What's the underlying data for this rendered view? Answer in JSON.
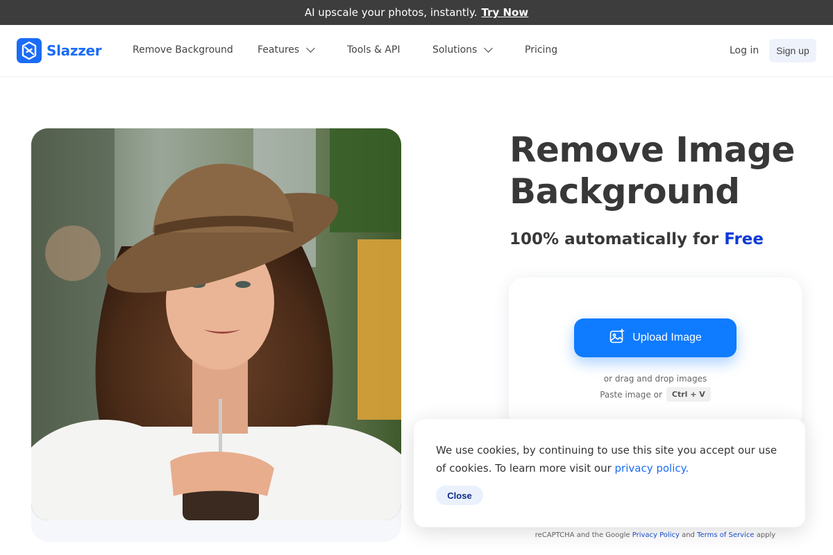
{
  "announcement": {
    "text": "AI upscale your photos, instantly.",
    "link": "Try Now"
  },
  "brand": {
    "name": "Slazzer",
    "color": "#1a6cf6"
  },
  "nav": {
    "items": [
      {
        "label": "Remove Background"
      },
      {
        "label": "Features"
      },
      {
        "label": "Tools & API"
      },
      {
        "label": "Solutions"
      },
      {
        "label": "Pricing"
      }
    ],
    "login": "Log in",
    "signup": "Sign up"
  },
  "hero": {
    "title": "Remove Image Background",
    "subtitle_prefix": "100% automatically for",
    "subtitle_highlight": "Free",
    "highlight_color": "#0e3ad8"
  },
  "upload": {
    "button_label": "Upload Image",
    "drag_text": "or drag and drop images",
    "paste_text": "Paste image or",
    "shortcut": "Ctrl + V",
    "button_color": "#0f7bff"
  },
  "legal": {
    "prefix": "reCAPTCHA and the Google",
    "privacy": "Privacy Policy",
    "and": "and",
    "terms": "Terms of Service",
    "suffix": "apply"
  },
  "cookie": {
    "text": "We use cookies, by continuing to use this site you accept our use of cookies.  To learn more visit our",
    "link": "privacy policy.",
    "close": "Close"
  },
  "icons": {
    "upload": "image-plus-icon",
    "chevron": "chevron-down-icon"
  }
}
